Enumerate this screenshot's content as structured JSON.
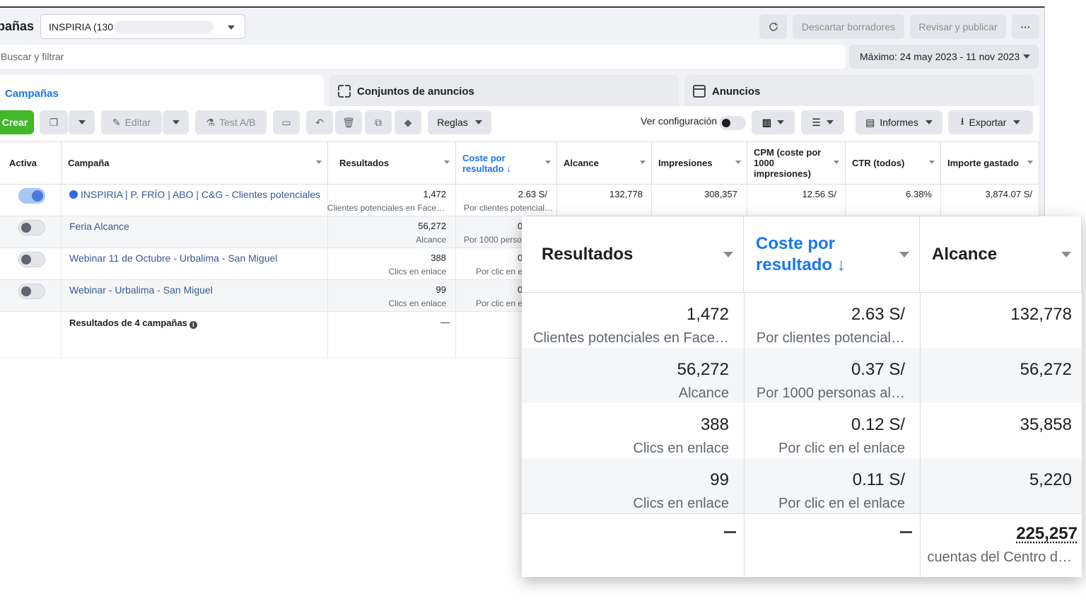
{
  "header": {
    "page_title": "pañas",
    "account_name": "INSPIRIA (130",
    "discard_label": "Descartar borradores",
    "publish_label": "Revisar y publicar",
    "more_label": "···"
  },
  "search": {
    "placeholder": "Buscar y filtrar"
  },
  "date_range": "Máximo: 24 may 2023 - 11 nov 2023",
  "tabs": [
    {
      "label": "Campañas"
    },
    {
      "label": "Conjuntos de anuncios"
    },
    {
      "label": "Anuncios"
    }
  ],
  "toolbar": {
    "create_label": "Crear",
    "edit_label": "Editar",
    "ab_label": "Test A/B",
    "rules_label": "Reglas",
    "view_config_label": "Ver configuración",
    "reports_label": "Informes",
    "export_label": "Exportar"
  },
  "table": {
    "columns": [
      "Activa",
      "Campaña",
      "Resultados",
      "Coste por resultado ↓",
      "Alcance",
      "Impresiones",
      "CPM (coste por 1000 impresiones)",
      "CTR (todos)",
      "Importe gastado"
    ],
    "rows": [
      {
        "active": true,
        "name": "INSPIRIA | P. FRÍO | ABO | C&G - Clientes potenciales",
        "results": "1,472",
        "results_type": "Clientes potenciales en Face…",
        "cost": "2.63 S/",
        "cost_type": "Por clientes potencial…",
        "reach": "132,778",
        "impressions": "308,357",
        "cpm": "12.56 S/",
        "ctr": "6.38%",
        "spent": "3,874.07 S/"
      },
      {
        "active": false,
        "name": "Feria Alcance",
        "results": "56,272",
        "results_type": "Alcance",
        "cost": "0",
        "cost_type": "Por 1000 person"
      },
      {
        "active": false,
        "name": "Webinar 11 de Octubre - Urbalima - San Miguel",
        "results": "388",
        "results_type": "Clics en enlace",
        "cost": "0",
        "cost_type": "Por clic en el"
      },
      {
        "active": false,
        "name": "Webinar - Urbalima - San Miguel",
        "results": "99",
        "results_type": "Clics en enlace",
        "cost": "0",
        "cost_type": "Por clic en el"
      }
    ],
    "summary_label": "Resultados de 4 campañas",
    "summary_results": "—"
  },
  "zoom": {
    "columns": [
      "Resultados",
      "Coste por resultado ↓",
      "Alcance"
    ],
    "rows": [
      {
        "results": "1,472",
        "results_type": "Clientes potenciales en Face…",
        "cost": "2.63 S/",
        "cost_type": "Por clientes potencial…",
        "reach": "132,778"
      },
      {
        "results": "56,272",
        "results_type": "Alcance",
        "cost": "0.37 S/",
        "cost_type": "Por 1000 personas al…",
        "reach": "56,272"
      },
      {
        "results": "388",
        "results_type": "Clics en enlace",
        "cost": "0.12 S/",
        "cost_type": "Por clic en el enlace",
        "reach": "35,858"
      },
      {
        "results": "99",
        "results_type": "Clics en enlace",
        "cost": "0.11 S/",
        "cost_type": "Por clic en el enlace",
        "reach": "5,220"
      }
    ],
    "summary": {
      "results": "—",
      "cost": "—",
      "reach": "225,257",
      "reach_note": "cuentas del Centro d…"
    }
  }
}
